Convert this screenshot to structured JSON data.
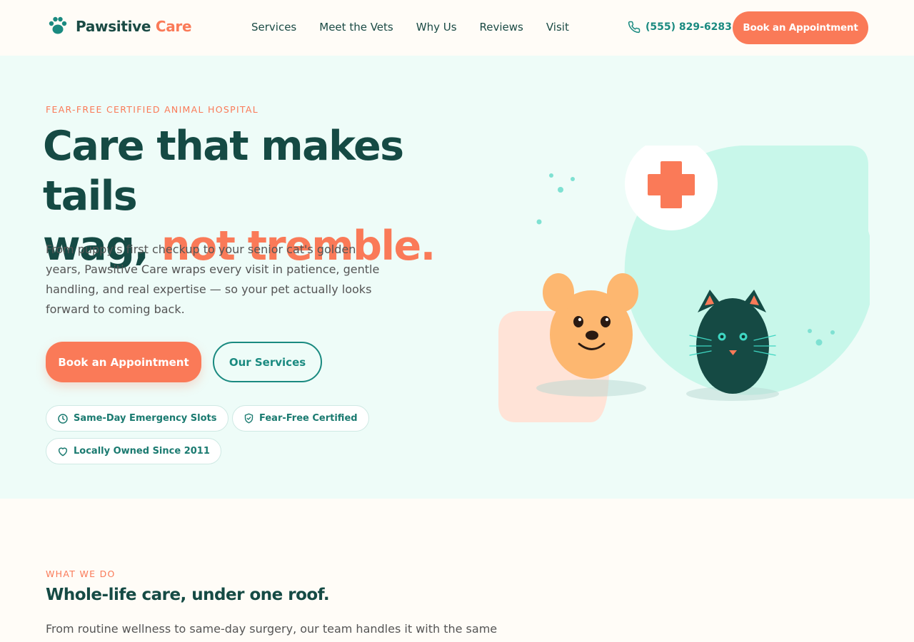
{
  "header": {
    "logo_name": "Pawsitive",
    "logo_accent": "Care",
    "nav": [
      "Services",
      "Meet the Vets",
      "Why Us",
      "Reviews",
      "Visit"
    ],
    "phone": "(555) 829-6283",
    "cta": "Book an Appointment"
  },
  "hero": {
    "eyebrow": "FEAR-FREE CERTIFIED ANIMAL HOSPITAL",
    "title_line1": "Care that makes tails",
    "title_line2_plain": "wag, ",
    "title_line2_accent": "not tremble.",
    "body": "From puppy's first checkup to your senior cat's golden years, Pawsitive Care wraps every visit in patience, gentle handling, and real expertise — so your pet actually looks forward to coming back.",
    "primary_button": "Book an Appointment",
    "secondary_button": "Our Services",
    "badges": [
      {
        "label": "Same-Day Emergency Slots",
        "icon": "clock-icon"
      },
      {
        "label": "Fear-Free Certified",
        "icon": "shield-check-icon"
      },
      {
        "label": "Locally Owned Since 2011",
        "icon": "heart-icon"
      }
    ]
  },
  "section": {
    "eyebrow": "WHAT WE DO",
    "title": "Whole-life care, under one roof.",
    "body": "From routine wellness to same-day surgery, our team handles it with the same"
  },
  "colors": {
    "accent": "#fa7a58",
    "primary": "#154a44",
    "teal": "#1a8a80",
    "hero_bg": "#eefcf8",
    "page_bg": "#fffcf7"
  }
}
